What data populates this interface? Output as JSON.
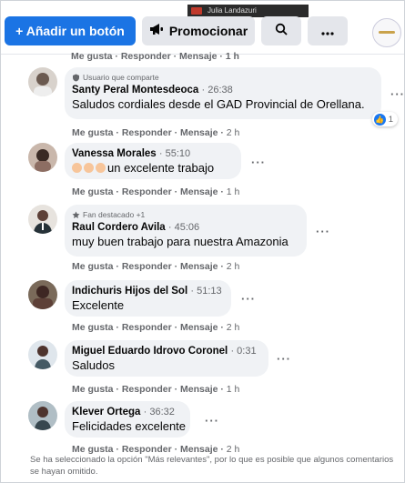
{
  "toolbar": {
    "video_label": "Julia Landazuri",
    "add_button": "+ Añadir un botón",
    "promote_button": "Promocionar"
  },
  "top_actions": "Me gusta · Responder · Mensaje · 1 h",
  "comments": [
    {
      "badge": "Usuario que comparte",
      "name": "Santy Peral Montesdeoca",
      "time": "26:38",
      "text": "Saludos cordiales desde el GAD Provincial de Orellana.",
      "reaction_count": "1",
      "actions": "Me gusta · Responder · Mensaje ·",
      "age": "2 h"
    },
    {
      "name": "Vanessa Morales",
      "time": "55:10",
      "text": "un excelente trabajo",
      "actions": "Me gusta · Responder · Mensaje ·",
      "age": "1 h"
    },
    {
      "badge": "Fan destacado +1",
      "name": "Raul Cordero Avila",
      "time": "45:06",
      "text": "muy buen trabajo para nuestra Amazonia",
      "actions": "Me gusta · Responder · Mensaje ·",
      "age": "2 h"
    },
    {
      "name": "Indichuris Hijos del Sol",
      "time": "51:13",
      "text": "Excelente",
      "actions": "Me gusta · Responder · Mensaje ·",
      "age": "2 h"
    },
    {
      "name": "Miguel Eduardo Idrovo Coronel",
      "time": "0:31",
      "text": "Saludos",
      "actions": "Me gusta · Responder · Mensaje ·",
      "age": "1 h"
    },
    {
      "name": "Klever Ortega",
      "time": "36:32",
      "text": "Felicidades excelente",
      "actions": "Me gusta · Responder · Mensaje ·",
      "age": "2 h"
    }
  ],
  "footer_note": "Se ha seleccionado la opción \"Más relevantes\", por lo que es posible que algunos comentarios se hayan omitido.",
  "colors": {
    "primary": "#1b74e4",
    "bubble": "#f0f2f5",
    "muted": "#65676b"
  },
  "icons": [
    "megaphone-icon",
    "search-icon",
    "more-icon",
    "like-icon",
    "shield-icon",
    "star-icon"
  ]
}
